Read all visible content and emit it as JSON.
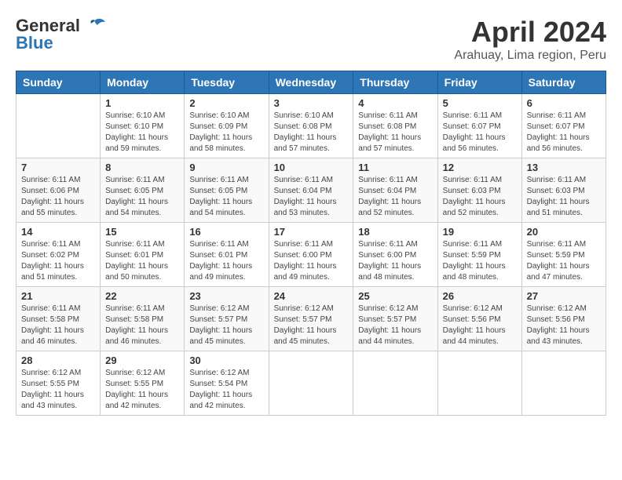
{
  "header": {
    "logo_general": "General",
    "logo_blue": "Blue",
    "month_title": "April 2024",
    "location": "Arahuay, Lima region, Peru"
  },
  "days_of_week": [
    "Sunday",
    "Monday",
    "Tuesday",
    "Wednesday",
    "Thursday",
    "Friday",
    "Saturday"
  ],
  "weeks": [
    [
      {
        "day": "",
        "info": ""
      },
      {
        "day": "1",
        "info": "Sunrise: 6:10 AM\nSunset: 6:10 PM\nDaylight: 11 hours\nand 59 minutes."
      },
      {
        "day": "2",
        "info": "Sunrise: 6:10 AM\nSunset: 6:09 PM\nDaylight: 11 hours\nand 58 minutes."
      },
      {
        "day": "3",
        "info": "Sunrise: 6:10 AM\nSunset: 6:08 PM\nDaylight: 11 hours\nand 57 minutes."
      },
      {
        "day": "4",
        "info": "Sunrise: 6:11 AM\nSunset: 6:08 PM\nDaylight: 11 hours\nand 57 minutes."
      },
      {
        "day": "5",
        "info": "Sunrise: 6:11 AM\nSunset: 6:07 PM\nDaylight: 11 hours\nand 56 minutes."
      },
      {
        "day": "6",
        "info": "Sunrise: 6:11 AM\nSunset: 6:07 PM\nDaylight: 11 hours\nand 56 minutes."
      }
    ],
    [
      {
        "day": "7",
        "info": "Sunrise: 6:11 AM\nSunset: 6:06 PM\nDaylight: 11 hours\nand 55 minutes."
      },
      {
        "day": "8",
        "info": "Sunrise: 6:11 AM\nSunset: 6:05 PM\nDaylight: 11 hours\nand 54 minutes."
      },
      {
        "day": "9",
        "info": "Sunrise: 6:11 AM\nSunset: 6:05 PM\nDaylight: 11 hours\nand 54 minutes."
      },
      {
        "day": "10",
        "info": "Sunrise: 6:11 AM\nSunset: 6:04 PM\nDaylight: 11 hours\nand 53 minutes."
      },
      {
        "day": "11",
        "info": "Sunrise: 6:11 AM\nSunset: 6:04 PM\nDaylight: 11 hours\nand 52 minutes."
      },
      {
        "day": "12",
        "info": "Sunrise: 6:11 AM\nSunset: 6:03 PM\nDaylight: 11 hours\nand 52 minutes."
      },
      {
        "day": "13",
        "info": "Sunrise: 6:11 AM\nSunset: 6:03 PM\nDaylight: 11 hours\nand 51 minutes."
      }
    ],
    [
      {
        "day": "14",
        "info": "Sunrise: 6:11 AM\nSunset: 6:02 PM\nDaylight: 11 hours\nand 51 minutes."
      },
      {
        "day": "15",
        "info": "Sunrise: 6:11 AM\nSunset: 6:01 PM\nDaylight: 11 hours\nand 50 minutes."
      },
      {
        "day": "16",
        "info": "Sunrise: 6:11 AM\nSunset: 6:01 PM\nDaylight: 11 hours\nand 49 minutes."
      },
      {
        "day": "17",
        "info": "Sunrise: 6:11 AM\nSunset: 6:00 PM\nDaylight: 11 hours\nand 49 minutes."
      },
      {
        "day": "18",
        "info": "Sunrise: 6:11 AM\nSunset: 6:00 PM\nDaylight: 11 hours\nand 48 minutes."
      },
      {
        "day": "19",
        "info": "Sunrise: 6:11 AM\nSunset: 5:59 PM\nDaylight: 11 hours\nand 48 minutes."
      },
      {
        "day": "20",
        "info": "Sunrise: 6:11 AM\nSunset: 5:59 PM\nDaylight: 11 hours\nand 47 minutes."
      }
    ],
    [
      {
        "day": "21",
        "info": "Sunrise: 6:11 AM\nSunset: 5:58 PM\nDaylight: 11 hours\nand 46 minutes."
      },
      {
        "day": "22",
        "info": "Sunrise: 6:11 AM\nSunset: 5:58 PM\nDaylight: 11 hours\nand 46 minutes."
      },
      {
        "day": "23",
        "info": "Sunrise: 6:12 AM\nSunset: 5:57 PM\nDaylight: 11 hours\nand 45 minutes."
      },
      {
        "day": "24",
        "info": "Sunrise: 6:12 AM\nSunset: 5:57 PM\nDaylight: 11 hours\nand 45 minutes."
      },
      {
        "day": "25",
        "info": "Sunrise: 6:12 AM\nSunset: 5:57 PM\nDaylight: 11 hours\nand 44 minutes."
      },
      {
        "day": "26",
        "info": "Sunrise: 6:12 AM\nSunset: 5:56 PM\nDaylight: 11 hours\nand 44 minutes."
      },
      {
        "day": "27",
        "info": "Sunrise: 6:12 AM\nSunset: 5:56 PM\nDaylight: 11 hours\nand 43 minutes."
      }
    ],
    [
      {
        "day": "28",
        "info": "Sunrise: 6:12 AM\nSunset: 5:55 PM\nDaylight: 11 hours\nand 43 minutes."
      },
      {
        "day": "29",
        "info": "Sunrise: 6:12 AM\nSunset: 5:55 PM\nDaylight: 11 hours\nand 42 minutes."
      },
      {
        "day": "30",
        "info": "Sunrise: 6:12 AM\nSunset: 5:54 PM\nDaylight: 11 hours\nand 42 minutes."
      },
      {
        "day": "",
        "info": ""
      },
      {
        "day": "",
        "info": ""
      },
      {
        "day": "",
        "info": ""
      },
      {
        "day": "",
        "info": ""
      }
    ]
  ]
}
